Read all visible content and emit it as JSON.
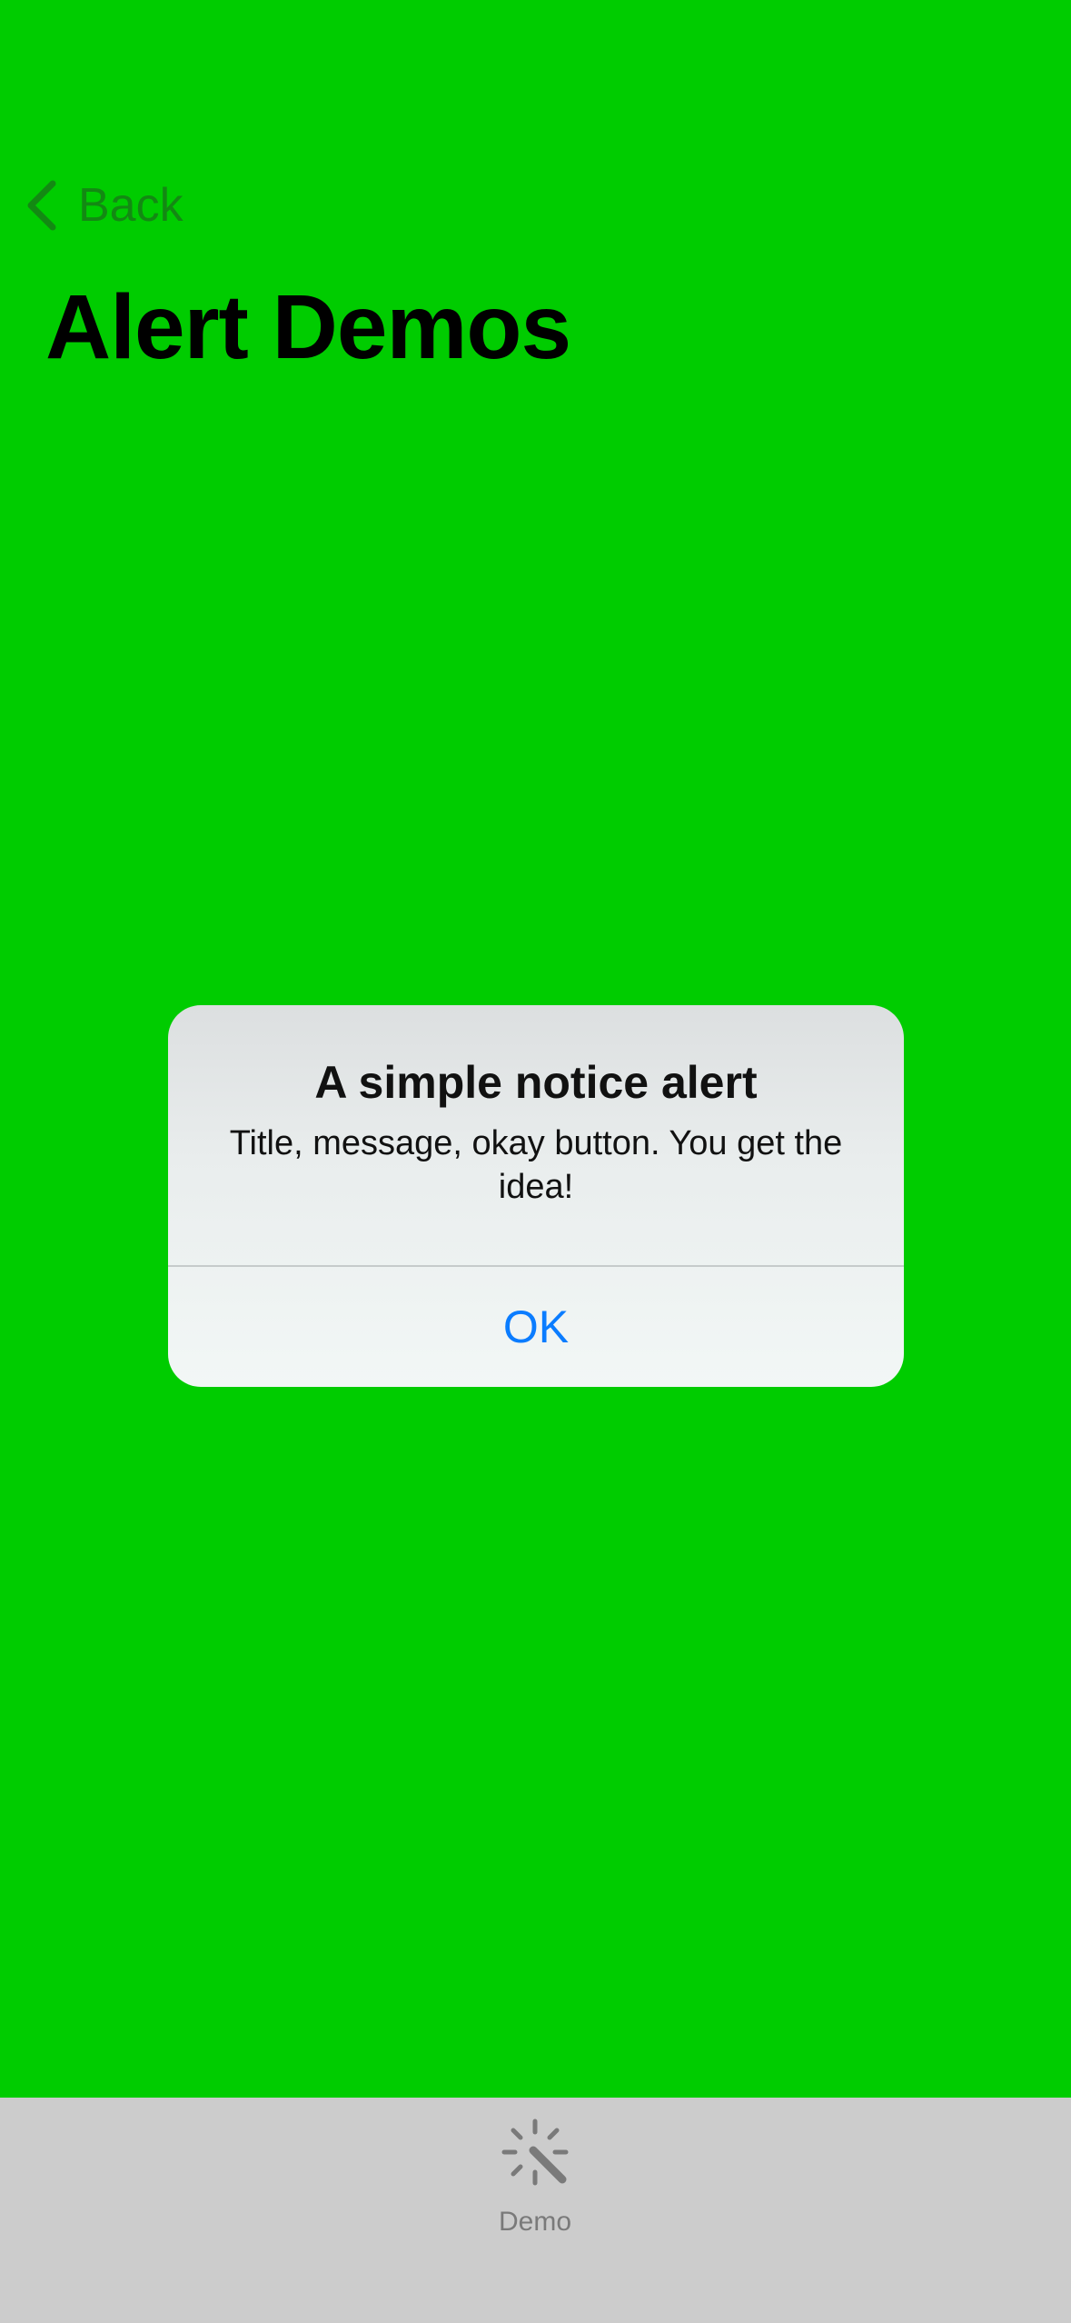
{
  "nav": {
    "back_label": "Back",
    "back_icon": "chevron-left-icon"
  },
  "page": {
    "title": "Alert Demos",
    "background_color": "#00cc00"
  },
  "alert": {
    "title": "A simple notice alert",
    "message": "Title, message, okay button. You get the idea!",
    "ok_label": "OK",
    "button_color": "#0a7cff"
  },
  "tabbar": {
    "items": [
      {
        "label": "Demo",
        "icon": "magic-wand-icon"
      }
    ]
  }
}
